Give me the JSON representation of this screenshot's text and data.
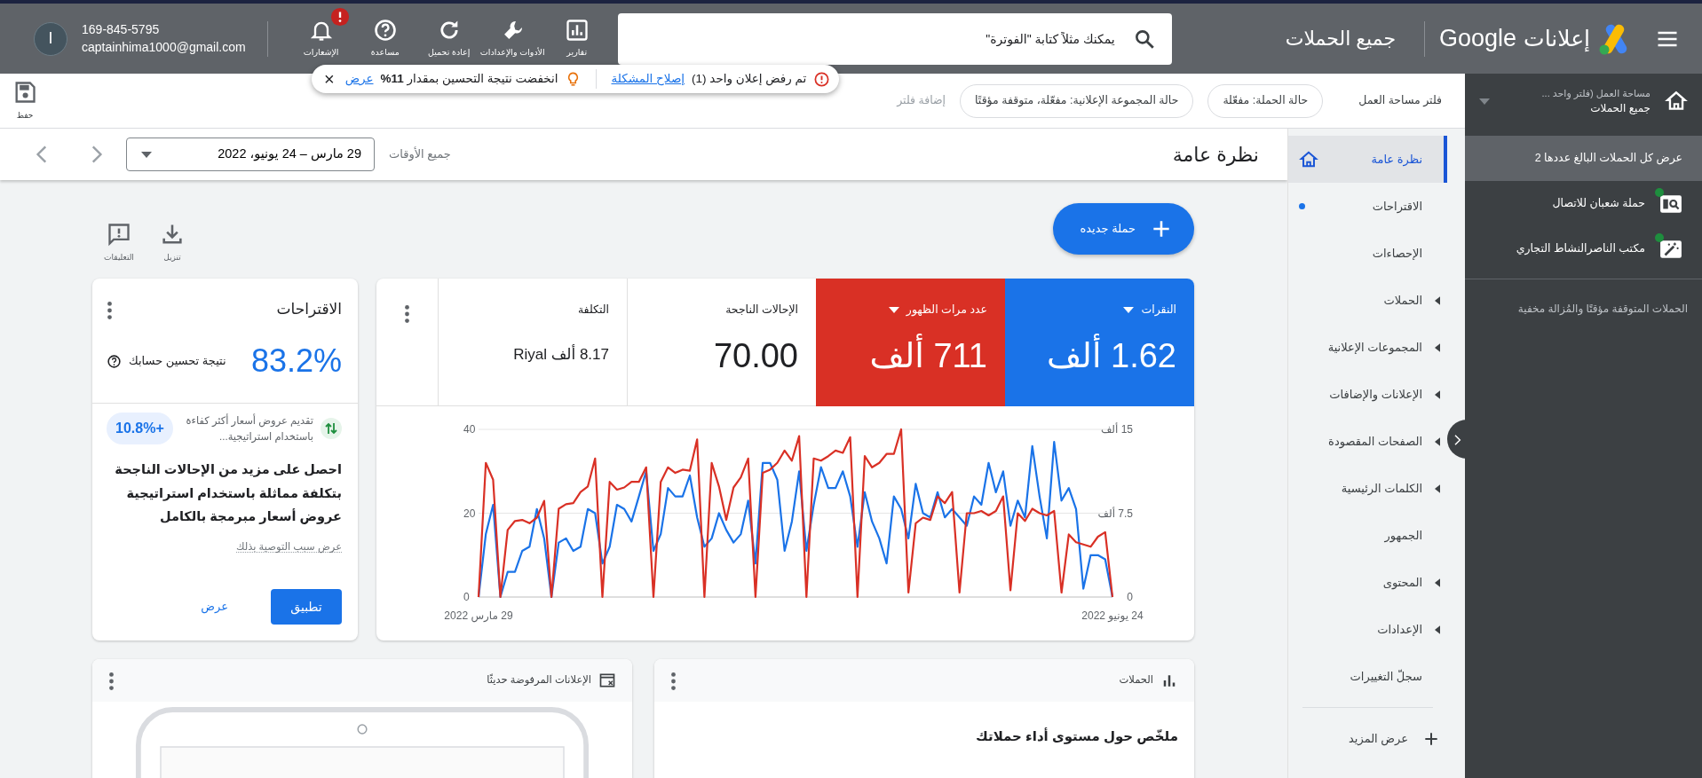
{
  "header": {
    "product": "إعلانات",
    "brand": "Google",
    "page_title": "جميع الحملات",
    "search": {
      "placeholder": "يمكنك مثلاً كتابة \"الفوترة\""
    },
    "tools": [
      {
        "kind": "reports",
        "label": "تقارير",
        "alert": false
      },
      {
        "kind": "tools",
        "label": "الأدوات والإعدادات",
        "alert": false
      },
      {
        "kind": "refresh",
        "label": "إعادة تحميل",
        "alert": false
      },
      {
        "kind": "help",
        "label": "مساعدة",
        "alert": false
      },
      {
        "kind": "notifications",
        "label": "الإشعارات",
        "alert": true
      }
    ],
    "account": {
      "phone": "169-845-5795",
      "email": "captainhima1000@gmail.com",
      "initial": "I"
    }
  },
  "notice": {
    "error_text": "تم رفض إعلان واحد (1)",
    "error_link": "إصلاح المشكلة",
    "tip_text": "انخفضت نتيجة التحسين بمقدار **11%**",
    "tip_link": "عرض",
    "close": "×"
  },
  "workspace": {
    "label": "مساحة العمل (فلتر واحد ...",
    "value": "جميع الحملات"
  },
  "campaigns_panel": {
    "items": [
      {
        "kind": "all",
        "label": "عرض كل الحملات البالغ عددها 2",
        "selected": true
      },
      {
        "kind": "search",
        "label": "حملة شعبان للاتصال",
        "selected": false,
        "color": "#1e8e3e"
      },
      {
        "kind": "smart",
        "label": "مكتب الناصرالنشاط التجاري",
        "selected": false,
        "color": "#1e8e3e"
      }
    ],
    "note": "الحملات المتوقفة مؤقتًا والمُزالة مخفية"
  },
  "filters": {
    "label": "فلتر مساحة العمل",
    "chips": [
      "حالة الحملة: مفعّلة",
      "حالة المجموعة الإعلانية: مفعّلة، متوقفة مؤقتًا"
    ],
    "add": "إضافة فلتر",
    "save": "حفظ"
  },
  "nav": {
    "items": [
      {
        "label": "نظرة عامة",
        "selected": true,
        "expandable": false,
        "alert": false
      },
      {
        "label": "الاقتراحات",
        "selected": false,
        "expandable": false,
        "alert": true
      },
      {
        "label": "الإحصاءات",
        "selected": false,
        "expandable": false,
        "alert": false
      },
      {
        "label": "الحملات",
        "selected": false,
        "expandable": true,
        "alert": false
      },
      {
        "label": "المجموعات الإعلانية",
        "selected": false,
        "expandable": true,
        "alert": false
      },
      {
        "label": "الإعلانات والإضافات",
        "selected": false,
        "expandable": true,
        "alert": false
      },
      {
        "label": "الصفحات المقصودة",
        "selected": false,
        "expandable": true,
        "alert": false
      },
      {
        "label": "الكلمات الرئيسية",
        "selected": false,
        "expandable": true,
        "alert": false
      },
      {
        "label": "الجمهور",
        "selected": false,
        "expandable": false,
        "alert": false
      },
      {
        "label": "المحتوى",
        "selected": false,
        "expandable": true,
        "alert": false
      },
      {
        "label": "الإعدادات",
        "selected": false,
        "expandable": true,
        "alert": false
      },
      {
        "label": "سجلّ التغييرات",
        "selected": false,
        "expandable": false,
        "alert": false
      }
    ],
    "more": "عرض المزيد"
  },
  "overview": {
    "title": "نظرة عامة",
    "range_label": "جميع الأوقات",
    "range": "29 مارس – 24 يونيو، 2022",
    "new_campaign": "حملة جديده",
    "actions": [
      {
        "kind": "download",
        "label": "تنزيل"
      },
      {
        "kind": "feedback",
        "label": "التعليقات"
      }
    ]
  },
  "performance": {
    "metrics": [
      {
        "label": "النقرات",
        "value": "1.62 ألف",
        "selected": true,
        "color": "#1a73e8"
      },
      {
        "label": "عدد مرات الظهور",
        "value": "711 ألف",
        "selected": true,
        "color": "#d93025"
      },
      {
        "label": "الإحالات الناجحة",
        "value": "70.00",
        "selected": false
      },
      {
        "label": "التكلفة",
        "value": "8.17 ألف Riyal",
        "selected": false
      }
    ],
    "chart_data": {
      "type": "line",
      "categories": [
        "29 مارس 2022",
        null,
        null,
        null,
        null,
        null,
        null,
        null,
        null,
        null,
        null,
        null,
        null,
        null,
        null,
        null,
        null,
        null,
        null,
        null,
        null,
        null,
        null,
        null,
        null,
        null,
        null,
        null,
        null,
        null,
        null,
        null,
        null,
        null,
        null,
        null,
        null,
        null,
        null,
        null,
        null,
        null,
        null,
        null,
        null,
        null,
        null,
        null,
        null,
        null,
        null,
        null,
        null,
        null,
        null,
        null,
        null,
        null,
        null,
        null,
        null,
        null,
        null,
        null,
        null,
        null,
        null,
        null,
        null,
        null,
        null,
        null,
        null,
        null,
        null,
        null,
        null,
        null,
        null,
        null,
        null,
        null,
        null,
        null,
        null,
        null,
        null,
        "24 يونيو 2022"
      ],
      "ylim": [
        0,
        40
      ],
      "yticks": [
        0,
        20,
        40
      ],
      "y2lim": [
        0,
        15
      ],
      "y2ticks": [
        {
          "value": 0,
          "label": "0"
        },
        {
          "value": 7.5,
          "label": "7.5 ألف"
        },
        {
          "value": 15,
          "label": "15 ألف"
        }
      ],
      "series": [
        {
          "color": "#1a73e8",
          "values": [
            0,
            15,
            22,
            0,
            6,
            6,
            11,
            12,
            21,
            14,
            0,
            13,
            14,
            11,
            12,
            21,
            20,
            8,
            12,
            22,
            21,
            18,
            24,
            30,
            11,
            15,
            26,
            24,
            24,
            29,
            19,
            12,
            14,
            20,
            16,
            13,
            15,
            23,
            8,
            32,
            32,
            28,
            11,
            18,
            30,
            11,
            22,
            31,
            26,
            26,
            30,
            24,
            12,
            25,
            18,
            14,
            8,
            24,
            21,
            14,
            27,
            20,
            19,
            25,
            19,
            21,
            19,
            17,
            24,
            22,
            32,
            25,
            30,
            17,
            23,
            19,
            36,
            24,
            14,
            37,
            23,
            26,
            21,
            2,
            10,
            10,
            9,
            0
          ]
        },
        {
          "color": "#d93025",
          "axis": "y2",
          "values": [
            0,
            12,
            10.5,
            0,
            6,
            6.8,
            6.9,
            6.6,
            7.1,
            8.6,
            0,
            7.9,
            8.3,
            8.4,
            9.4,
            9.9,
            12.4,
            0,
            10.3,
            9.6,
            9.8,
            10.3,
            10.3,
            11.6,
            0,
            10.3,
            11.6,
            11.1,
            11.4,
            11.3,
            14.1,
            0,
            12,
            9.9,
            6.9,
            9.8,
            10.7,
            12.4,
            0,
            11.1,
            11.4,
            12,
            13.1,
            12.2,
            14.4,
            0,
            12.4,
            12.2,
            12.6,
            13.1,
            12.9,
            14.3,
            0,
            12.6,
            11.6,
            12,
            12.8,
            12.8,
            15,
            0.4,
            6.6,
            7.1,
            6.9,
            9,
            8.4,
            9.4,
            0.4,
            7.5,
            7.5,
            7.7,
            7.3,
            7.7,
            9,
            0.6,
            7.5,
            6.8,
            7.9,
            7.5,
            7.3,
            7.7,
            0.4,
            5.6,
            4.9,
            4.7,
            4.5,
            5.4,
            5.8,
            0
          ]
        }
      ]
    }
  },
  "suggestions": {
    "title": "الاقتراحات",
    "score": "83.2%",
    "score_label": "نتيجة تحسين حسابك",
    "item": {
      "text": "تقديم عروض أسعار أكثر كفاءة باستخدام استراتيجية...",
      "uplift": "+10.8%"
    },
    "headline": "احصل على مزيد من الإحالات الناجحة بتكلفة مماثلة باستخدام استراتيجية عروض أسعار مبرمجة بالكامل",
    "reason": "عرض سبب التوصية بذلك",
    "apply": "تطبيق",
    "view": "عرض"
  },
  "bottom_cards": [
    {
      "kind": "campaigns",
      "title": "الحملات",
      "body": "ملخّص حول مستوى أداء حملاتك"
    },
    {
      "kind": "rejected_ads",
      "title": "الإعلانات المرفوضة حديثًا"
    }
  ]
}
